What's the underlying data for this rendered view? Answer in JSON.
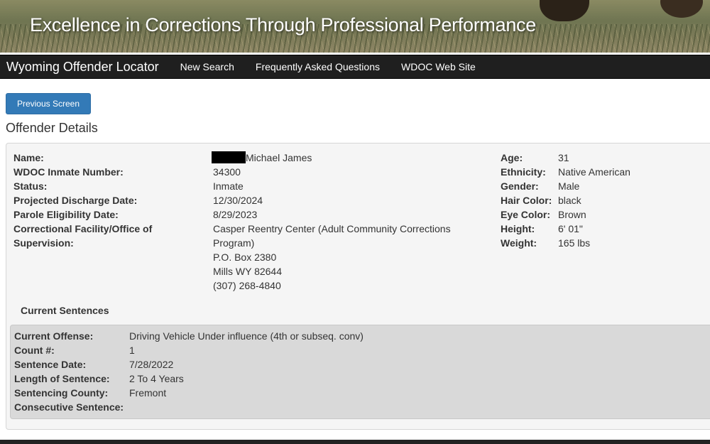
{
  "banner": {
    "slogan": "Excellence in Corrections Through Professional Performance"
  },
  "navbar": {
    "brand": "Wyoming Offender Locator",
    "links": [
      "New Search",
      "Frequently Asked Questions",
      "WDOC Web Site"
    ]
  },
  "prev_button": "Previous Screen",
  "page_title": "Offender Details",
  "details": {
    "name_label": "Name:",
    "name_value": "Michael James",
    "inmate_number_label": "WDOC Inmate Number:",
    "inmate_number_value": "34300",
    "status_label": "Status:",
    "status_value": "Inmate",
    "discharge_label": "Projected Discharge Date:",
    "discharge_value": "12/30/2024",
    "parole_label": "Parole Eligibility Date:",
    "parole_value": "8/29/2023",
    "facility_label_line1": "Correctional Facility/Office of",
    "facility_label_line2": "Supervision:",
    "facility_value_line1": "Casper Reentry Center (Adult Community Corrections",
    "facility_value_line2": "Program)",
    "facility_value_line3": "P.O. Box 2380",
    "facility_value_line4": "Mills WY 82644",
    "facility_value_line5": "(307) 268-4840"
  },
  "physical": {
    "age_label": "Age:",
    "age_value": "31",
    "ethnicity_label": "Ethnicity:",
    "ethnicity_value": "Native American",
    "gender_label": "Gender:",
    "gender_value": "Male",
    "hair_label": "Hair Color:",
    "hair_value": "black",
    "eye_label": "Eye Color:",
    "eye_value": "Brown",
    "height_label": "Height:",
    "height_value": "6' 01\"",
    "weight_label": "Weight:",
    "weight_value": "165 lbs"
  },
  "sentences": {
    "heading": "Current Sentences",
    "offense_label": "Current Offense:",
    "offense_value": "Driving Vehicle Under influence (4th or subseq. conv)",
    "count_label": "Count #:",
    "count_value": "1",
    "date_label": "Sentence Date:",
    "date_value": "7/28/2022",
    "length_label": "Length of Sentence:",
    "length_value": "2 To 4 Years",
    "county_label": "Sentencing County:",
    "county_value": "Fremont",
    "consecutive_label": "Consecutive Sentence:",
    "consecutive_value": ""
  },
  "colors": {
    "navbar_bg": "#1f1f1f",
    "button_bg": "#337ab7",
    "panel_bg": "#f5f5f5",
    "sentence_bg": "#d9d9d9"
  }
}
